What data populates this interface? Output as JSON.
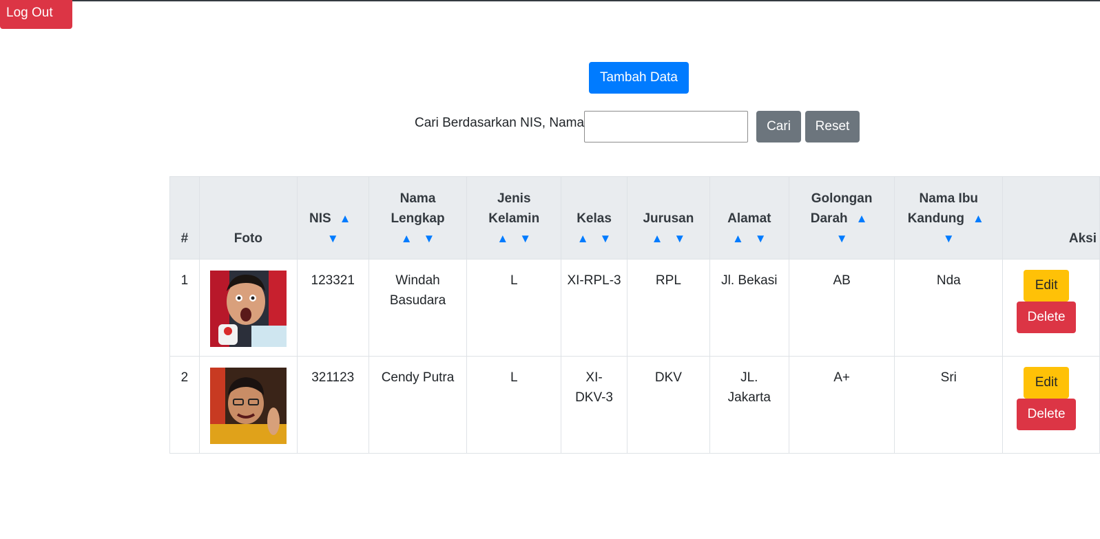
{
  "header": {
    "logout_label": "Log Out"
  },
  "toolbar": {
    "add_label": "Tambah Data",
    "search_label": "Cari Berdasarkan NIS, Nama:",
    "search_value": "",
    "search_button": "Cari",
    "reset_button": "Reset"
  },
  "sort_icons": {
    "up": "▲",
    "down": "▼"
  },
  "table": {
    "columns": {
      "no": "#",
      "foto": "Foto",
      "nis": "NIS",
      "nama_1": "Nama",
      "nama_2": "Lengkap",
      "jk_1": "Jenis",
      "jk_2": "Kelamin",
      "kelas": "Kelas",
      "jurusan": "Jurusan",
      "alamat": "Alamat",
      "goldar_1": "Golongan",
      "goldar_2": "Darah",
      "ibu_1": "Nama Ibu",
      "ibu_2": "Kandung",
      "aksi": "Aksi"
    },
    "rows": [
      {
        "no": "1",
        "nis": "123321",
        "nama": "Windah Basudara",
        "jk": "L",
        "kelas": "XI-RPL-3",
        "jurusan": "RPL",
        "alamat": "Jl. Bekasi",
        "goldar": "AB",
        "ibu": "Nda",
        "edit": "Edit",
        "delete": "Delete"
      },
      {
        "no": "2",
        "nis": "321123",
        "nama": "Cendy Putra",
        "jk": "L",
        "kelas": "XI-DKV-3",
        "jurusan": "DKV",
        "alamat": "JL. Jakarta",
        "goldar": "A+",
        "ibu": "Sri",
        "edit": "Edit",
        "delete": "Delete"
      }
    ]
  }
}
